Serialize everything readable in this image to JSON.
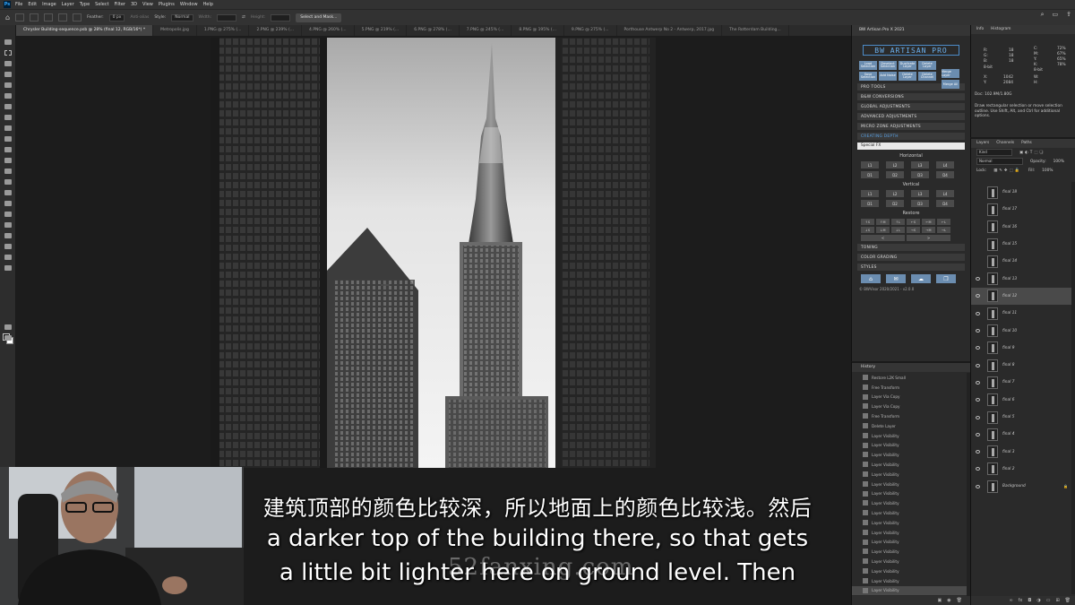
{
  "menu": {
    "app_icon": "Ps",
    "items": [
      "File",
      "Edit",
      "Image",
      "Layer",
      "Type",
      "Select",
      "Filter",
      "3D",
      "View",
      "Plugins",
      "Window",
      "Help"
    ]
  },
  "options": {
    "feather_label": "Feather:",
    "feather_value": "0 px",
    "antialias": "Anti-alias",
    "style_label": "Style:",
    "style_value": "Normal",
    "width_label": "Width:",
    "height_label": "Height:",
    "select_mask": "Select and Mask..."
  },
  "tabs": [
    "Chrysler Building-sequence.psb @ 28% (final 12, RGB/16*) *",
    "Metropolis.jpg",
    "1.PNG @ 275% (...",
    "2.PNG @ 239% (...",
    "4.PNG @ 260% (...",
    "5.PNG @ 219% (...",
    "6.PNG @ 278% (...",
    "7.PNG @ 245% (...",
    "8.PNG @ 195% (...",
    "9.PNG @ 275% (...",
    "Porthouse Antwerp No 2 - Antwerp, 2017.jpg",
    "The Rotterdam Building..."
  ],
  "plugin": {
    "title": "BW Artisan Pro X 2021",
    "logo": "BW ARTISAN PRO",
    "buttons": [
      "Load Selection",
      "Deselect Selection",
      "Duplicate Layer",
      "Delete Layer",
      "Save Selection",
      "Add Noise",
      "Delete Layer",
      "Delete Channel",
      "Merge Layer",
      "Merge All"
    ],
    "sections_top": [
      "PRO TOOLS",
      "B&W CONVERSIONS",
      "GLOBAL ADJUSTMENTS",
      "ADVANCED ADJUSTMENTS",
      "MICRO ZONE ADJUSTMENTS",
      "CREATING DEPTH"
    ],
    "dropdown": "Special FX",
    "horizontal": "Horizontal",
    "vertical": "Vertical",
    "restore": "Restore",
    "row_l": [
      "L1",
      "L2",
      "L3",
      "L4"
    ],
    "row_d": [
      "D1",
      "D2",
      "D3",
      "D4"
    ],
    "restore_btns": [
      "↑S",
      "↑M",
      "↑L",
      "←S",
      "←M",
      "←L",
      "↓S",
      "↓M",
      "↓L",
      "→S",
      "→M",
      "→L"
    ],
    "restore_arrows": [
      "<",
      ">"
    ],
    "sections_bottom": [
      "TONING",
      "COLOR GRADING",
      "STYLES"
    ],
    "footer": "© BWVisor 2020/2021 - v2.0.0"
  },
  "history": {
    "title": "History",
    "items": [
      "Restore L2K Small",
      "Free Transform",
      "Layer Via Copy",
      "Layer Via Copy",
      "Free Transform",
      "Delete Layer",
      "Layer Visibility",
      "Layer Visibility",
      "Layer Visibility",
      "Layer Visibility",
      "Layer Visibility",
      "Layer Visibility",
      "Layer Visibility",
      "Layer Visibility",
      "Layer Visibility",
      "Layer Visibility",
      "Layer Visibility",
      "Layer Visibility",
      "Layer Visibility",
      "Layer Visibility",
      "Layer Visibility",
      "Layer Visibility",
      "Layer Visibility"
    ]
  },
  "info": {
    "tabs": [
      "Info",
      "Histogram"
    ],
    "r": "R:",
    "g": "G:",
    "b": "B:",
    "rv": "18",
    "gv": "18",
    "bv": "18",
    "c": "C:",
    "m": "M:",
    "y": "Y:",
    "k": "K:",
    "cv": "72%",
    "mv": "67%",
    "yv": "65%",
    "kv": "78%",
    "bit1": "8-bit",
    "bit2": "8-bit",
    "x": "X:",
    "yy": "Y:",
    "xv": "1042",
    "yyv": "2084",
    "w": "W:",
    "h": "H:",
    "doc": "Doc: 102.9M/1.80G",
    "hint": "Draw rectangular selection or move selection outline. Use Shift, Alt, and Ctrl for additional options."
  },
  "layers": {
    "tabs": [
      "Layers",
      "Channels",
      "Paths"
    ],
    "kind": "Kind",
    "blend": "Normal",
    "opacity_label": "Opacity:",
    "opacity": "100%",
    "lock_label": "Lock:",
    "fill_label": "Fill:",
    "fill": "100%",
    "items": [
      "final 18",
      "final 17",
      "final 16",
      "final 15",
      "final 14",
      "final 13",
      "final 12",
      "final 11",
      "final 10",
      "final 9",
      "final 8",
      "final 7",
      "final 6",
      "final 5",
      "final 4",
      "final 3",
      "final 2",
      "Background"
    ],
    "visible_from": 5,
    "selected": 6
  },
  "subtitles": {
    "zh": "建筑顶部的颜色比较深，所以地面上的颜色比较浅。然后",
    "en1": "a darker top of the building there, so that gets",
    "en2": "a little bit lighter here on ground level. Then"
  },
  "watermark": "52fanxing.com"
}
